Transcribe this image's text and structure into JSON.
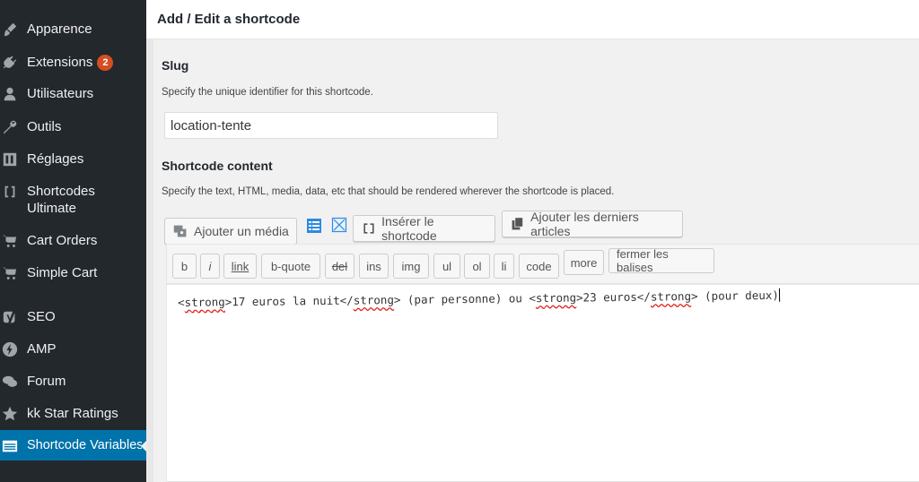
{
  "sidebar": {
    "items": [
      {
        "label": "Apparence",
        "icon": "paintbrush-icon"
      },
      {
        "label": "Extensions",
        "icon": "plugin-icon",
        "badge": "2"
      },
      {
        "label": "Utilisateurs",
        "icon": "users-icon"
      },
      {
        "label": "Outils",
        "icon": "wrench-icon"
      },
      {
        "label": "Réglages",
        "icon": "settings-icon"
      },
      {
        "label": "Shortcodes Ultimate",
        "icon": "brackets-icon"
      },
      {
        "label": "Cart Orders",
        "icon": "cart-icon"
      },
      {
        "label": "Simple Cart",
        "icon": "cart-icon"
      },
      {
        "label": "SEO",
        "icon": "yoast-icon"
      },
      {
        "label": "AMP",
        "icon": "amp-icon"
      },
      {
        "label": "Forum",
        "icon": "forum-icon"
      },
      {
        "label": "kk Star Ratings",
        "icon": "star-icon"
      },
      {
        "label": "Shortcode Variables",
        "icon": "table-icon",
        "active": true
      }
    ]
  },
  "panel": {
    "title": "Add / Edit a shortcode",
    "slug_label": "Slug",
    "slug_desc": "Specify the unique identifier for this shortcode.",
    "slug_value": "location-tente",
    "content_label": "Shortcode content",
    "content_desc": "Specify the text, HTML, media, data, etc that should be rendered wherever the shortcode is placed."
  },
  "media_buttons": {
    "add_media": "Ajouter un média",
    "insert_shortcode": "Insérer le shortcode",
    "add_latest": "Ajouter les derniers articles"
  },
  "quicktags": [
    "b",
    "i",
    "link",
    "b-quote",
    "del",
    "ins",
    "img",
    "ul",
    "ol",
    "li",
    "code",
    "more",
    "fermer les balises"
  ],
  "editor": {
    "content": "<strong>17 euros la nuit</strong> (par personne) ou <strong>23 euros</strong> (pour deux)"
  },
  "colors": {
    "sidebar_bg": "#23282d",
    "active_bg": "#0073aa",
    "badge_bg": "#d54e21"
  }
}
